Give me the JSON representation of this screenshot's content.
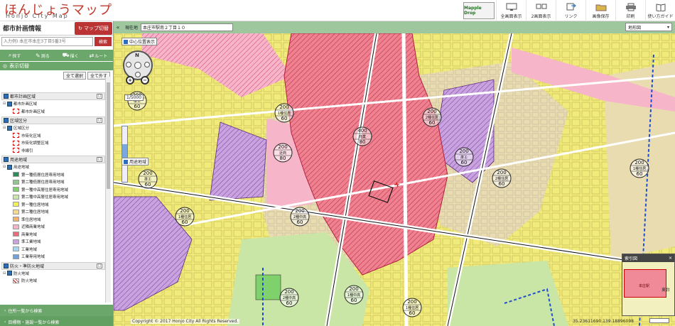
{
  "header": {
    "logo_main": "ほんじょうマップ",
    "logo_sub": "Honjo City Map",
    "badge": "Mapple Drop",
    "tools": [
      {
        "label": "全画面表示",
        "icon": "monitor-icon"
      },
      {
        "label": "2画面表示",
        "icon": "dual-screen-icon"
      },
      {
        "label": "リンク",
        "icon": "link-icon"
      },
      {
        "label": "画像保存",
        "icon": "folder-icon"
      },
      {
        "label": "印刷",
        "icon": "printer-icon"
      },
      {
        "label": "使い方ガイド",
        "icon": "guide-icon"
      }
    ]
  },
  "sidebar": {
    "title": "都市計画情報",
    "map_list_button": "マップ切替",
    "search_placeholder": "入力例) 本庄市本庄3丁目5番3号",
    "search_button": "検索",
    "tools": [
      "探す",
      "測る",
      "描く",
      "ルート"
    ],
    "layer_header": "表示切替",
    "select_all": "全て選択",
    "deselect_all": "全て外す",
    "groups": [
      {
        "label": "都市計画区域",
        "toggle": "□",
        "rows": [
          {
            "label": "都市計画区域",
            "type": "sub"
          },
          {
            "label": "都市計画区域",
            "type": "item",
            "swatch": "dash"
          }
        ]
      },
      {
        "label": "区域区分",
        "toggle": "□",
        "rows": [
          {
            "label": "区域区分",
            "type": "sub"
          },
          {
            "label": "市街化区域",
            "type": "item",
            "swatch": "dash"
          },
          {
            "label": "市街化調整区域",
            "type": "item",
            "swatch": "dash"
          },
          {
            "label": "非線引",
            "type": "item",
            "swatch": "dash"
          }
        ]
      },
      {
        "label": "用途地域",
        "toggle": "□",
        "rows": [
          {
            "label": "用途地域",
            "type": "sub"
          },
          {
            "label": "第一種低層住居専用地域",
            "type": "item",
            "swatch": "#2e8b57"
          },
          {
            "label": "第二種低層住居専用地域",
            "type": "item",
            "swatch": "#8fc78f"
          },
          {
            "label": "第一種中高層住居専用地域",
            "type": "item",
            "swatch": "#7fd16b"
          },
          {
            "label": "第二種中高層住居専用地域",
            "type": "item",
            "swatch": "#c9e8a8"
          },
          {
            "label": "第一種住居地域",
            "type": "item",
            "swatch": "#f2ef55"
          },
          {
            "label": "第二種住居地域",
            "type": "item",
            "swatch": "#f6d98a"
          },
          {
            "label": "準住居地域",
            "type": "item",
            "swatch": "#f2b36b"
          },
          {
            "label": "近隣商業地域",
            "type": "item",
            "swatch": "#f4b3c8"
          },
          {
            "label": "商業地域",
            "type": "item",
            "swatch": "#ef6b7c"
          },
          {
            "label": "準工業地域",
            "type": "item",
            "swatch": "#c9a2e0"
          },
          {
            "label": "工業地域",
            "type": "item",
            "swatch": "#a5d6f2"
          },
          {
            "label": "工業専用地域",
            "type": "item",
            "swatch": "#6fa3df"
          }
        ]
      },
      {
        "label": "防火・準防火地域",
        "toggle": "□",
        "rows": [
          {
            "label": "防火地域",
            "type": "sub"
          },
          {
            "label": "防火地域",
            "type": "item",
            "swatch": "hatch"
          }
        ]
      }
    ],
    "bottom_btn1": "住所一覧から検索",
    "bottom_btn2": "目標物・施設一覧から検索"
  },
  "map_toolbar": {
    "collapse": "«",
    "address_label": "現在地",
    "address_value": "本庄市駅南２丁目１０",
    "map_select": "地形図"
  },
  "map": {
    "layer_check": "中心位置表示",
    "layer_check2": "用途地域",
    "nav_n": "N",
    "zoom_in": "+",
    "zoom_out": "−",
    "scale": "1/5000",
    "copyright": "Copyright © 2017 Honjo City All Rights Reserved.",
    "coords": "35.23611690,139.18896098",
    "overview_title": "索引図",
    "overview_close": "×",
    "overview_label": "本庄駅",
    "overview_label2": "東台",
    "zone_labels": [
      {
        "top": "200",
        "mid": "1種住居",
        "bot": "60"
      },
      {
        "top": "200",
        "mid": "2種住居",
        "bot": "60"
      },
      {
        "top": "200",
        "mid": "準工",
        "bot": "60"
      },
      {
        "top": "400",
        "mid": "商業",
        "bot": "80"
      },
      {
        "top": "200",
        "mid": "近商",
        "bot": "80"
      },
      {
        "top": "200",
        "mid": "準工",
        "bot": "60"
      },
      {
        "top": "200",
        "mid": "1種住居",
        "bot": "60"
      },
      {
        "top": "200",
        "mid": "2種住居",
        "bot": "60"
      },
      {
        "top": "200",
        "mid": "準工",
        "bot": "60"
      },
      {
        "top": "200",
        "mid": "1種住居",
        "bot": "60"
      },
      {
        "top": "200",
        "mid": "2種中高",
        "bot": "60"
      },
      {
        "top": "200",
        "mid": "2種中高",
        "bot": "60"
      },
      {
        "top": "200",
        "mid": "1種住居",
        "bot": "60"
      },
      {
        "top": "200",
        "mid": "1種中高",
        "bot": "60"
      }
    ]
  }
}
